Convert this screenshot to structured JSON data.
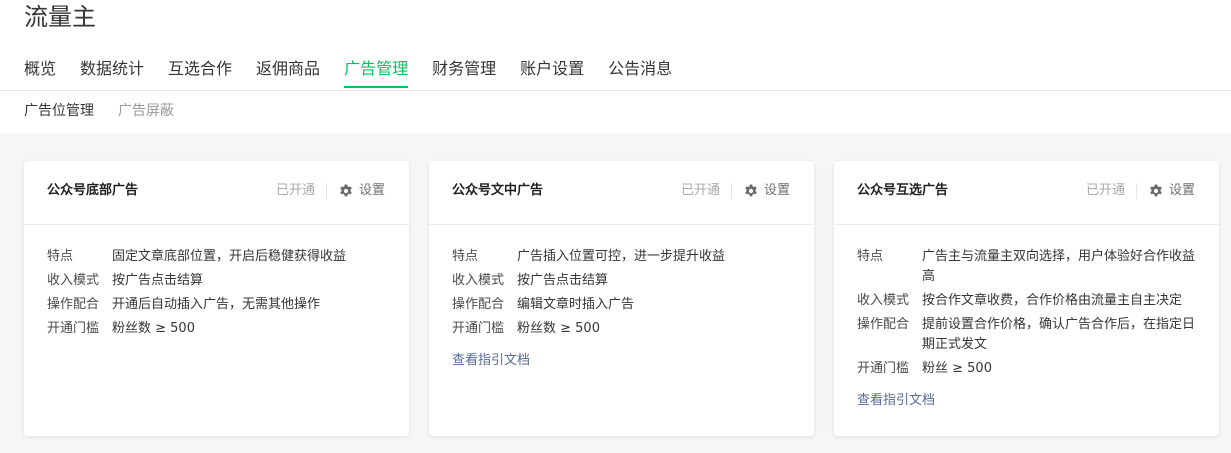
{
  "header": {
    "title": "流量主"
  },
  "nav": {
    "tabs": [
      {
        "label": "概览",
        "active": false
      },
      {
        "label": "数据统计",
        "active": false
      },
      {
        "label": "互选合作",
        "active": false
      },
      {
        "label": "返佣商品",
        "active": false
      },
      {
        "label": "广告管理",
        "active": true
      },
      {
        "label": "财务管理",
        "active": false
      },
      {
        "label": "账户设置",
        "active": false
      },
      {
        "label": "公告消息",
        "active": false
      }
    ]
  },
  "subnav": {
    "tabs": [
      {
        "label": "广告位管理",
        "active": true
      },
      {
        "label": "广告屏蔽",
        "active": false
      }
    ]
  },
  "colors": {
    "accent": "#07c160",
    "link": "#576b95"
  },
  "cards": [
    {
      "title": "公众号底部广告",
      "status": "已开通",
      "settings_label": "设置",
      "settings_icon": "gear-icon",
      "rows": [
        {
          "key": "特点",
          "value": "固定文章底部位置，开启后稳健获得收益"
        },
        {
          "key": "收入模式",
          "value": "按广告点击结算"
        },
        {
          "key": "操作配合",
          "value": "开通后自动插入广告，无需其他操作"
        },
        {
          "key": "开通门槛",
          "value": "粉丝数 ≥ 500"
        }
      ],
      "link": ""
    },
    {
      "title": "公众号文中广告",
      "status": "已开通",
      "settings_label": "设置",
      "settings_icon": "gear-icon",
      "rows": [
        {
          "key": "特点",
          "value": "广告插入位置可控，进一步提升收益"
        },
        {
          "key": "收入模式",
          "value": "按广告点击结算"
        },
        {
          "key": "操作配合",
          "value": "编辑文章时插入广告"
        },
        {
          "key": "开通门槛",
          "value": "粉丝数 ≥ 500"
        }
      ],
      "link": "查看指引文档"
    },
    {
      "title": "公众号互选广告",
      "status": "已开通",
      "settings_label": "设置",
      "settings_icon": "gear-icon",
      "rows": [
        {
          "key": "特点",
          "value": "广告主与流量主双向选择，用户体验好合作收益高"
        },
        {
          "key": "收入模式",
          "value": "按合作文章收费，合作价格由流量主自主决定"
        },
        {
          "key": "操作配合",
          "value": "提前设置合作价格，确认广告合作后，在指定日期正式发文"
        },
        {
          "key": "开通门槛",
          "value": "粉丝 ≥ 500"
        }
      ],
      "link": "查看指引文档"
    }
  ]
}
